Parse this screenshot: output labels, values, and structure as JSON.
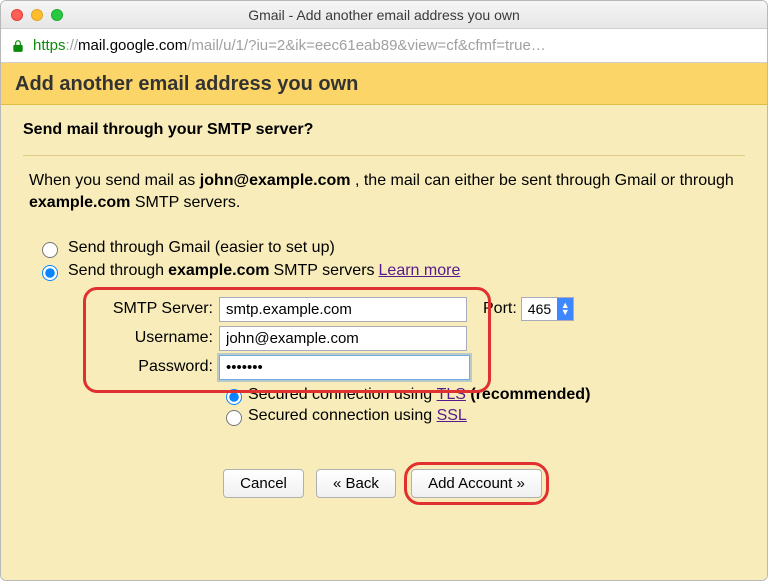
{
  "window": {
    "title": "Gmail - Add another email address you own"
  },
  "url": {
    "scheme": "https",
    "host": "mail.google.com",
    "path": "/mail/u/1/?iu=2&ik=eec61eab89&view=cf&cfmf=true…"
  },
  "header": {
    "heading": "Add another email address you own"
  },
  "subhead": "Send mail through your SMTP server?",
  "info": {
    "part1": "When you send mail as ",
    "email": "john@example.com",
    "part2": ", the mail can either be sent through Gmail or through ",
    "domain": "example.com",
    "part3": " SMTP servers."
  },
  "radios": {
    "gmail_label": "Send through Gmail (easier to set up)",
    "smtp_label_pre": "Send through ",
    "smtp_domain": "example.com",
    "smtp_label_post": " SMTP servers ",
    "learn_more": "Learn more",
    "selected": "smtp"
  },
  "form": {
    "smtp_label": "SMTP Server:",
    "smtp_value": "smtp.example.com",
    "port_label": "Port:",
    "port_value": "465",
    "user_label": "Username:",
    "user_value": "john@example.com",
    "pass_label": "Password:",
    "pass_value": "•••••••"
  },
  "security": {
    "tls_pre": "Secured connection using ",
    "tls_link": "TLS",
    "tls_post": " (recommended)",
    "ssl_pre": "Secured connection using ",
    "ssl_link": "SSL",
    "selected": "tls"
  },
  "buttons": {
    "cancel": "Cancel",
    "back": "« Back",
    "add": "Add Account »"
  }
}
